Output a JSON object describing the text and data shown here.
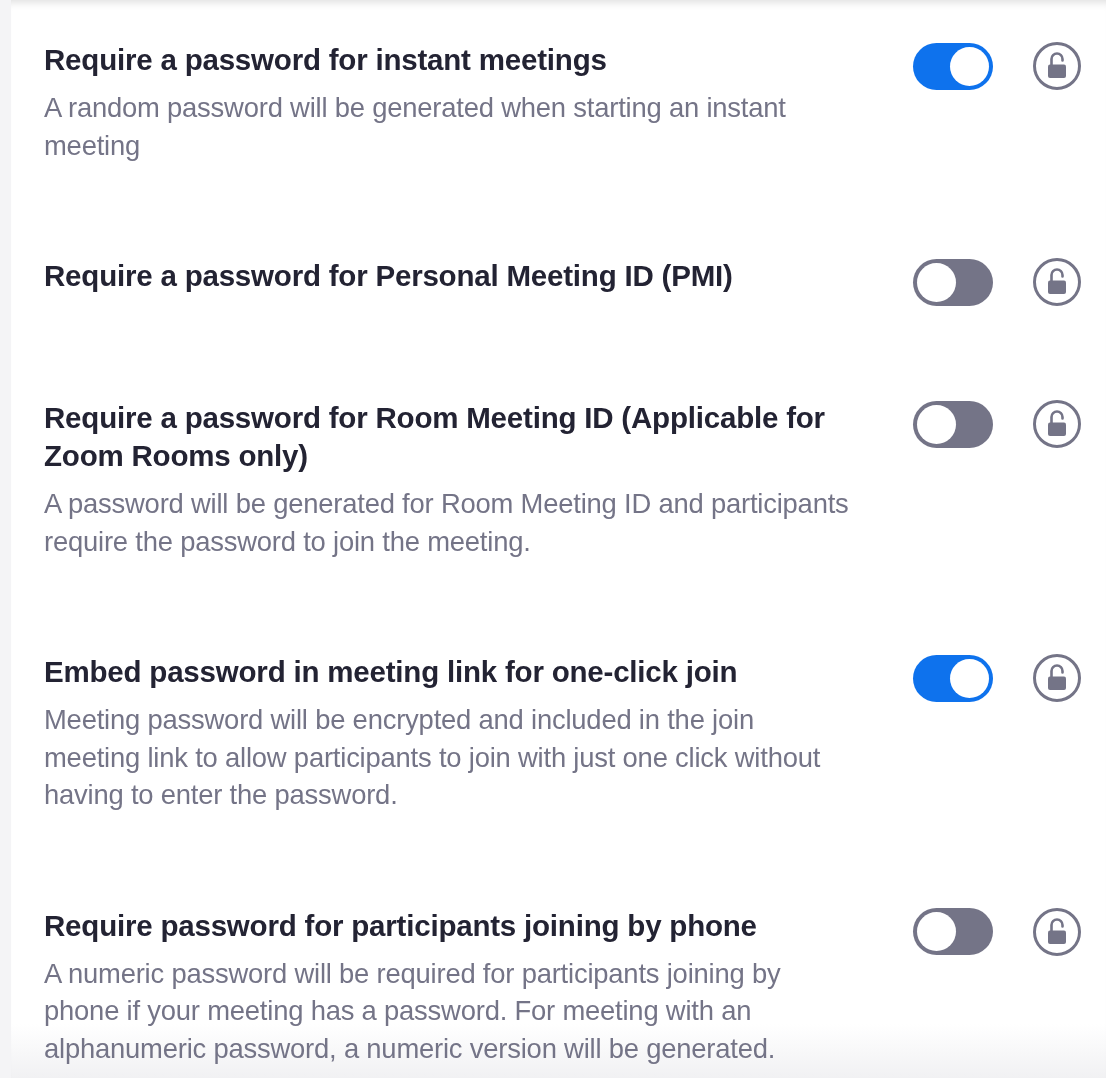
{
  "settings": [
    {
      "title": "Require a password for instant meetings",
      "description": "A random password will be generated when starting an instant meeting",
      "on": true,
      "locked": false
    },
    {
      "title": "Require a password for Personal Meeting ID (PMI)",
      "on": false,
      "locked": false
    },
    {
      "title": "Require a password for Room Meeting ID (Applicable for Zoom Rooms only)",
      "description": "A password will be generated for Room Meeting ID and participants require the password to join the meeting.",
      "on": false,
      "locked": false
    },
    {
      "title": "Embed password in meeting link for one-click join",
      "description": "Meeting password will be encrypted and included in the join meeting link to allow participants to join with just one click without having to enter the password.",
      "on": true,
      "locked": false
    },
    {
      "title": "Require password for participants joining by phone",
      "description": "A numeric password will be required for participants joining by phone if your meeting has a password. For meeting with an alphanumeric password, a numeric version will be generated.",
      "on": false,
      "locked": false
    }
  ]
}
